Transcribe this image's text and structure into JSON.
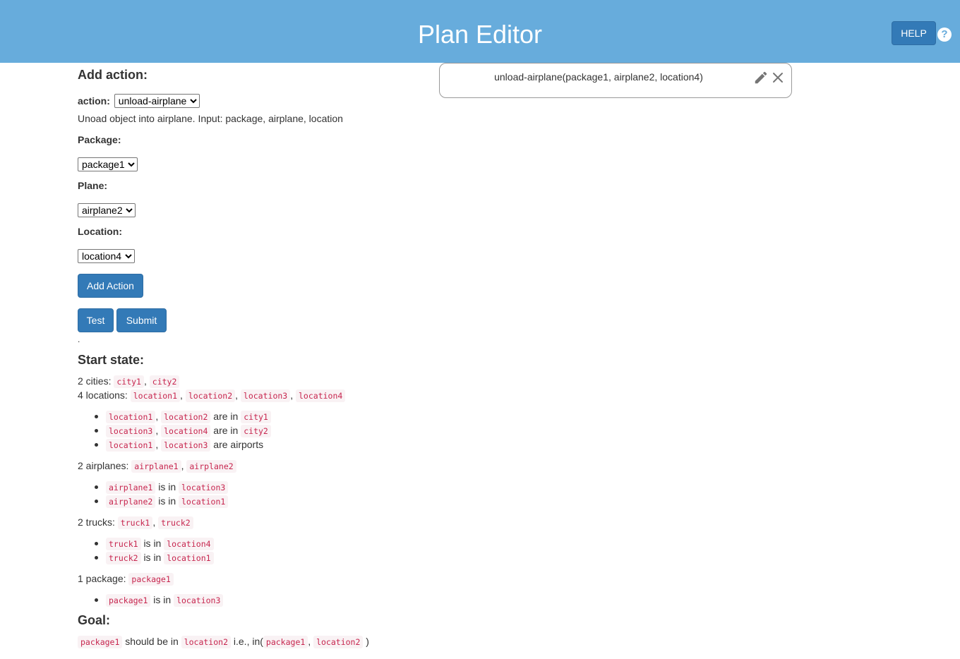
{
  "header": {
    "title": "Plan Editor",
    "help_label": "HELP",
    "help_icon": "?"
  },
  "add_action": {
    "heading": "Add action:",
    "action_label": "action:",
    "action_selected": "unload-airplane",
    "description": "Unoad object into airplane. Input: package, airplane, location",
    "package_label": "Package:",
    "package_selected": "package1",
    "plane_label": "Plane:",
    "plane_selected": "airplane2",
    "location_label": "Location:",
    "location_selected": "location4",
    "add_button": "Add Action",
    "test_button": "Test",
    "submit_button": "Submit",
    "dot": "."
  },
  "plan": {
    "steps": [
      "unload-airplane(package1, airplane2, location4)"
    ]
  },
  "start_state": {
    "heading": "Start state:",
    "cities_text": "2 cities:",
    "cities": [
      "city1",
      "city2"
    ],
    "locations_text": "4 locations:",
    "locations": [
      "location1",
      "location2",
      "location3",
      "location4"
    ],
    "location_facts": [
      {
        "items": [
          "location1",
          "location2"
        ],
        "text": "are in",
        "target": "city1"
      },
      {
        "items": [
          "location3",
          "location4"
        ],
        "text": "are in",
        "target": "city2"
      },
      {
        "items": [
          "location1",
          "location3"
        ],
        "text": "are airports"
      }
    ],
    "airplanes_text": "2 airplanes:",
    "airplanes": [
      "airplane1",
      "airplane2"
    ],
    "airplane_facts": [
      {
        "item": "airplane1",
        "text": "is in",
        "target": "location3"
      },
      {
        "item": "airplane2",
        "text": "is in",
        "target": "location1"
      }
    ],
    "trucks_text": "2 trucks:",
    "trucks": [
      "truck1",
      "truck2"
    ],
    "truck_facts": [
      {
        "item": "truck1",
        "text": "is in",
        "target": "location4"
      },
      {
        "item": "truck2",
        "text": "is in",
        "target": "location1"
      }
    ],
    "packages_text": "1 package:",
    "packages": [
      "package1"
    ],
    "package_facts": [
      {
        "item": "package1",
        "text": "is in",
        "target": "location3"
      }
    ]
  },
  "goal": {
    "heading": "Goal:",
    "item": "package1",
    "text": "should be in",
    "target": "location2",
    "ie_text": "i.e., in(",
    "args": [
      "package1",
      "location2"
    ],
    "close_paren": ")"
  },
  "colors": {
    "header_bg": "#67acdc",
    "button_bg": "#337ab7",
    "code_fg": "#c7254e",
    "code_bg": "#f9f2f4"
  },
  "icons": {
    "edit": "pencil-icon",
    "close": "close-icon",
    "help": "question-circle-icon"
  }
}
